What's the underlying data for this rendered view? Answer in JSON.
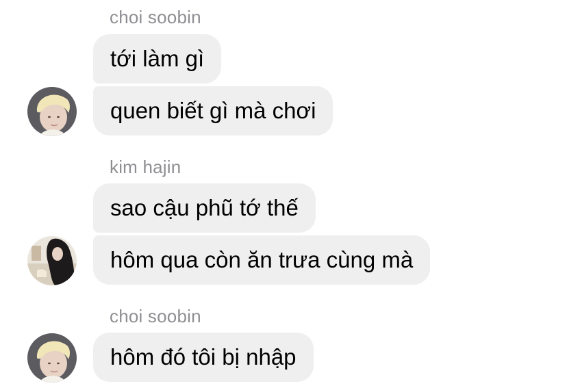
{
  "messages": [
    {
      "sender": "choi soobin",
      "lines": [
        "tới làm gì",
        "quen biết gì mà chơi"
      ],
      "avatar": "blond-person-avatar"
    },
    {
      "sender": "kim hajin",
      "lines": [
        "sao cậu phũ tớ thế",
        "hôm qua còn ăn trưa cùng mà"
      ],
      "avatar": "dark-hair-person-avatar"
    },
    {
      "sender": "choi soobin",
      "lines": [
        "hôm đó tôi bị nhập"
      ],
      "avatar": "blond-person-avatar"
    }
  ],
  "colors": {
    "bubble": "#efeff0",
    "sender_name": "#8e8e93",
    "text": "#000000"
  }
}
